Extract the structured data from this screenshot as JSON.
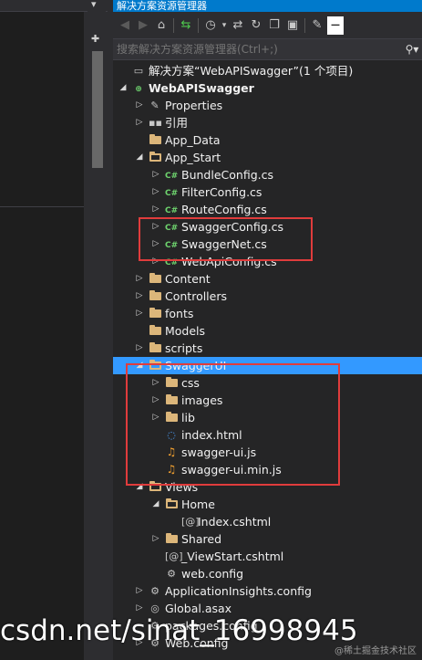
{
  "window": {
    "title": "解决方案资源管理器"
  },
  "search": {
    "placeholder": "搜索解决方案资源管理器(Ctrl+;)"
  },
  "toolbar": [
    "back-icon",
    "forward-icon",
    "home-icon",
    "sync-icon",
    "history-icon",
    "dropdown-icon",
    "switch-icon",
    "refresh-icon",
    "copy-icon",
    "collapse-icon",
    "properties-icon",
    "pin-icon"
  ],
  "tree": [
    {
      "label": "解决方案“WebAPISwagger”(1 个项目)",
      "depth": 0,
      "icon": "solution-icon",
      "expander": "none",
      "bold": false,
      "selected": false
    },
    {
      "label": "WebAPISwagger",
      "depth": 0,
      "icon": "project-icon",
      "expander": "expanded",
      "bold": true,
      "selected": false
    },
    {
      "label": "Properties",
      "depth": 1,
      "icon": "wrench-icon",
      "expander": "collapsed",
      "bold": false,
      "selected": false
    },
    {
      "label": "引用",
      "depth": 1,
      "icon": "references-icon",
      "expander": "collapsed",
      "bold": false,
      "selected": false
    },
    {
      "label": "App_Data",
      "depth": 1,
      "icon": "folder-icon",
      "expander": "none",
      "bold": false,
      "selected": false
    },
    {
      "label": "App_Start",
      "depth": 1,
      "icon": "folder-open-icon",
      "expander": "expanded",
      "bold": false,
      "selected": false
    },
    {
      "label": "BundleConfig.cs",
      "depth": 2,
      "icon": "csharp-icon",
      "expander": "collapsed",
      "bold": false,
      "selected": false
    },
    {
      "label": "FilterConfig.cs",
      "depth": 2,
      "icon": "csharp-icon",
      "expander": "collapsed",
      "bold": false,
      "selected": false
    },
    {
      "label": "RouteConfig.cs",
      "depth": 2,
      "icon": "csharp-icon",
      "expander": "collapsed",
      "bold": false,
      "selected": false
    },
    {
      "label": "SwaggerConfig.cs",
      "depth": 2,
      "icon": "csharp-icon",
      "expander": "collapsed",
      "bold": false,
      "selected": false
    },
    {
      "label": "SwaggerNet.cs",
      "depth": 2,
      "icon": "csharp-icon",
      "expander": "collapsed",
      "bold": false,
      "selected": false
    },
    {
      "label": "WebApiConfig.cs",
      "depth": 2,
      "icon": "csharp-icon",
      "expander": "collapsed",
      "bold": false,
      "selected": false
    },
    {
      "label": "Content",
      "depth": 1,
      "icon": "folder-icon",
      "expander": "collapsed",
      "bold": false,
      "selected": false
    },
    {
      "label": "Controllers",
      "depth": 1,
      "icon": "folder-icon",
      "expander": "collapsed",
      "bold": false,
      "selected": false
    },
    {
      "label": "fonts",
      "depth": 1,
      "icon": "folder-icon",
      "expander": "collapsed",
      "bold": false,
      "selected": false
    },
    {
      "label": "Models",
      "depth": 1,
      "icon": "folder-icon",
      "expander": "none",
      "bold": false,
      "selected": false
    },
    {
      "label": "scripts",
      "depth": 1,
      "icon": "folder-icon",
      "expander": "collapsed",
      "bold": false,
      "selected": false
    },
    {
      "label": "SwaggerUI",
      "depth": 1,
      "icon": "folder-open-icon",
      "expander": "expanded",
      "bold": false,
      "selected": true
    },
    {
      "label": "css",
      "depth": 2,
      "icon": "folder-icon",
      "expander": "collapsed",
      "bold": false,
      "selected": false
    },
    {
      "label": "images",
      "depth": 2,
      "icon": "folder-icon",
      "expander": "collapsed",
      "bold": false,
      "selected": false
    },
    {
      "label": "lib",
      "depth": 2,
      "icon": "folder-icon",
      "expander": "collapsed",
      "bold": false,
      "selected": false
    },
    {
      "label": "index.html",
      "depth": 2,
      "icon": "html-icon",
      "expander": "none",
      "bold": false,
      "selected": false
    },
    {
      "label": "swagger-ui.js",
      "depth": 2,
      "icon": "js-icon",
      "expander": "none",
      "bold": false,
      "selected": false
    },
    {
      "label": "swagger-ui.min.js",
      "depth": 2,
      "icon": "js-icon",
      "expander": "none",
      "bold": false,
      "selected": false
    },
    {
      "label": "Views",
      "depth": 1,
      "icon": "folder-open-icon",
      "expander": "expanded",
      "bold": false,
      "selected": false
    },
    {
      "label": "Home",
      "depth": 2,
      "icon": "folder-open-icon",
      "expander": "expanded",
      "bold": false,
      "selected": false
    },
    {
      "label": "Index.cshtml",
      "depth": 3,
      "icon": "cshtml-icon",
      "expander": "none",
      "bold": false,
      "selected": false
    },
    {
      "label": "Shared",
      "depth": 2,
      "icon": "folder-icon",
      "expander": "collapsed",
      "bold": false,
      "selected": false
    },
    {
      "label": "_ViewStart.cshtml",
      "depth": 2,
      "icon": "cshtml-icon",
      "expander": "none",
      "bold": false,
      "selected": false
    },
    {
      "label": "web.config",
      "depth": 2,
      "icon": "config-icon",
      "expander": "none",
      "bold": false,
      "selected": false
    },
    {
      "label": "ApplicationInsights.config",
      "depth": 1,
      "icon": "config-icon",
      "expander": "collapsed",
      "bold": false,
      "selected": false
    },
    {
      "label": "Global.asax",
      "depth": 1,
      "icon": "asax-icon",
      "expander": "collapsed",
      "bold": false,
      "selected": false
    },
    {
      "label": "packages.config",
      "depth": 1,
      "icon": "config-icon",
      "expander": "none",
      "bold": false,
      "selected": false
    },
    {
      "label": "Web.config",
      "depth": 1,
      "icon": "config-icon",
      "expander": "collapsed",
      "bold": false,
      "selected": false
    }
  ],
  "watermark": {
    "text": "csdn.net/sinat_16998945",
    "corner": "@稀土掘金技术社区"
  },
  "colors": {
    "accent": "#007acc",
    "selection": "#3399ff",
    "highlight_box": "#e03c3c",
    "folder": "#dcb67a",
    "csharp": "#6ed46e",
    "js": "#f0a030"
  }
}
